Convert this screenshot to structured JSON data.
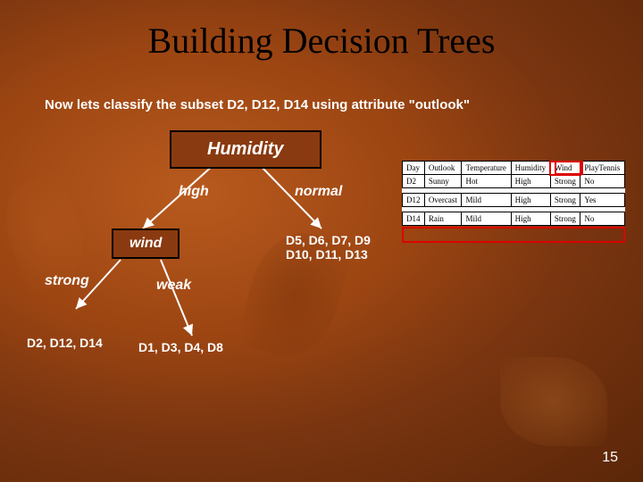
{
  "title": "Building Decision Trees",
  "subtitle_pre": "Now  lets classify the  subset D2, D12, D14 using attribute ",
  "subtitle_attr": "\"outlook\"",
  "tree": {
    "root": "Humidity",
    "left_edge": "high",
    "right_edge": "normal",
    "right_leaf_line1": "D5, D6, D7, D9",
    "right_leaf_line2": "D10, D11, D13",
    "left_node": "wind",
    "left_left_edge": "strong",
    "left_right_edge": "weak",
    "left_left_leaf": "D2, D12, D14",
    "left_right_leaf": "D1, D3, D4, D8"
  },
  "table": {
    "headers": [
      "Day",
      "Outlook",
      "Temperature",
      "Humidity",
      "Wind",
      "PlayTennis"
    ],
    "rows": [
      [
        "D2",
        "Sunny",
        "Hot",
        "High",
        "Strong",
        "No"
      ],
      [
        "D12",
        "Overcast",
        "Mild",
        "High",
        "Strong",
        "Yes"
      ],
      [
        "D14",
        "Rain",
        "Mild",
        "High",
        "Strong",
        "No"
      ]
    ],
    "highlight_col_index": 4,
    "highlight_row_index": 2
  },
  "slide_number": "15",
  "chart_data": {
    "type": "table",
    "title": "Subset D2, D12, D14 by outlook",
    "columns": [
      "Day",
      "Outlook",
      "Temperature",
      "Humidity",
      "Wind",
      "PlayTennis"
    ],
    "rows": [
      [
        "D2",
        "Sunny",
        "Hot",
        "High",
        "Strong",
        "No"
      ],
      [
        "D12",
        "Overcast",
        "Mild",
        "High",
        "Strong",
        "Yes"
      ],
      [
        "D14",
        "Rain",
        "Mild",
        "High",
        "Strong",
        "No"
      ]
    ]
  }
}
